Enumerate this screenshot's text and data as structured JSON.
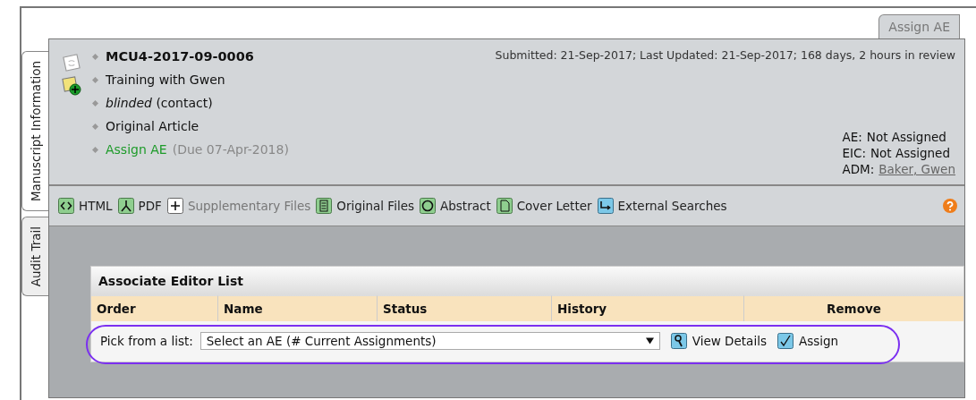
{
  "side_tabs": [
    {
      "label": "Manuscript Information",
      "selected": true
    },
    {
      "label": "Audit Trail",
      "selected": false
    }
  ],
  "top_tab": "Assign AE",
  "manuscript": {
    "items": [
      {
        "kind": "id",
        "text": "MCU4-2017-09-0006"
      },
      {
        "kind": "title",
        "text": "Training with Gwen"
      },
      {
        "kind": "author",
        "text": "*blinded* (contact)"
      },
      {
        "kind": "type",
        "text": "Original Article"
      },
      {
        "kind": "task",
        "text": "Assign AE",
        "note": "(Due 07-Apr-2018)"
      }
    ],
    "dates": "Submitted: 21-Sep-2017; Last Updated: 21-Sep-2017; 168 days, 2 hours in review",
    "roles": [
      {
        "label": "AE:",
        "value": "Not Assigned",
        "link": false
      },
      {
        "label": "EIC:",
        "value": "Not Assigned",
        "link": false
      },
      {
        "label": "ADM:",
        "value": "Baker, Gwen",
        "link": true
      }
    ]
  },
  "toolbar": [
    {
      "label": "HTML",
      "kind": "code",
      "disabled": false
    },
    {
      "label": "PDF",
      "kind": "pdf",
      "disabled": false
    },
    {
      "label": "Supplementary Files",
      "kind": "plus",
      "disabled": true
    },
    {
      "label": "Original Files",
      "kind": "files",
      "disabled": false
    },
    {
      "label": "Abstract",
      "kind": "circle",
      "disabled": false
    },
    {
      "label": "Cover Letter",
      "kind": "page",
      "disabled": false
    },
    {
      "label": "External Searches",
      "kind": "arrow",
      "disabled": false
    }
  ],
  "editor_list": {
    "title": "Associate Editor List",
    "columns": [
      "Order",
      "Name",
      "Status",
      "History",
      "Remove"
    ],
    "pick_label": "Pick from a list:",
    "select_value": "Select an AE (# Current Assignments)",
    "actions": [
      {
        "label": "View Details",
        "kind": "magnifier"
      },
      {
        "label": "Assign",
        "kind": "check"
      }
    ]
  }
}
